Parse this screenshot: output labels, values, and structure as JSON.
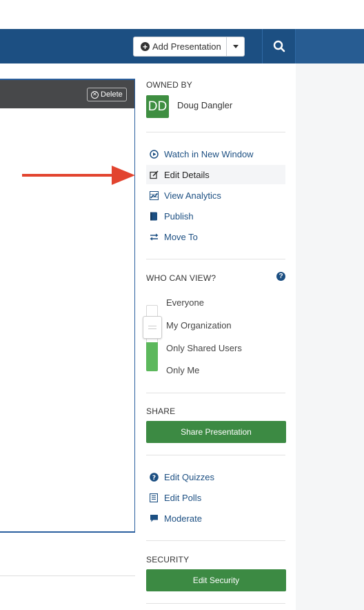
{
  "header": {
    "add_presentation_label": "Add Presentation"
  },
  "main_panel": {
    "delete_label": "Delete"
  },
  "sidebar": {
    "owned_by_title": "OWNED BY",
    "owner_initials": "DD",
    "owner_name": "Doug Dangler",
    "actions": [
      {
        "label": "Watch in New Window",
        "icon": "play-circle-icon"
      },
      {
        "label": "Edit Details",
        "icon": "edit-icon"
      },
      {
        "label": "View Analytics",
        "icon": "analytics-icon"
      },
      {
        "label": "Publish",
        "icon": "book-icon"
      },
      {
        "label": "Move To",
        "icon": "exchange-icon"
      }
    ],
    "who_can_view_title": "WHO CAN VIEW?",
    "view_options": [
      "Everyone",
      "My Organization",
      "Only Shared Users",
      "Only Me"
    ],
    "share_title": "SHARE",
    "share_button_label": "Share Presentation",
    "tools": [
      {
        "label": "Edit Quizzes",
        "icon": "question-circle-icon"
      },
      {
        "label": "Edit Polls",
        "icon": "list-icon"
      },
      {
        "label": "Moderate",
        "icon": "comment-icon"
      }
    ],
    "security_title": "SECURITY",
    "security_button_label": "Edit Security"
  },
  "colors": {
    "header": "#1c4f82",
    "accent_green": "#3c8a43",
    "link": "#1c4f82",
    "arrow": "#e2442f"
  }
}
